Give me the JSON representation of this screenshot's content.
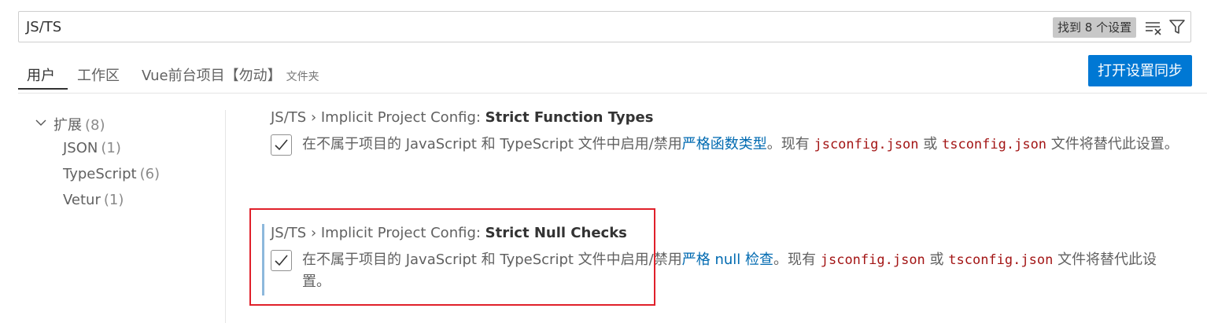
{
  "search": {
    "value": "JS/TS",
    "result_count": "找到 8 个设置"
  },
  "tabs": [
    {
      "label": "用户"
    },
    {
      "label": "工作区"
    },
    {
      "label": "Vue前台项目【勿动】",
      "sub": "文件夹"
    }
  ],
  "sync_button": "打开设置同步",
  "toc": {
    "group": {
      "label": "扩展",
      "count": "(8)"
    },
    "items": [
      {
        "label": "JSON",
        "count": "(1)"
      },
      {
        "label": "TypeScript",
        "count": "(6)"
      },
      {
        "label": "Vetur",
        "count": "(1)"
      }
    ]
  },
  "settings": [
    {
      "title_prefix": "JS/TS › Implicit Project Config: ",
      "title_name": "Strict Function Types",
      "checked": true,
      "desc_pre": "在不属于项目的 JavaScript 和 TypeScript 文件中启用/禁用",
      "desc_link": "严格函数类型",
      "desc_mid": "。现有 ",
      "code1": "jsconfig.json",
      "desc_or": " 或 ",
      "code2": "tsconfig.json",
      "desc_post": " 文件将替代此设置。"
    },
    {
      "title_prefix": "JS/TS › Implicit Project Config: ",
      "title_name": "Strict Null Checks",
      "checked": true,
      "desc_pre": "在不属于项目的 JavaScript 和 TypeScript 文件中启用/禁用",
      "desc_link": "严格 null 检查",
      "desc_mid": "。现有 ",
      "code1": "jsconfig.json",
      "desc_or": " 或 ",
      "code2": "tsconfig.json",
      "desc_post": " 文件将替代此设置。"
    }
  ],
  "colors": {
    "accent": "#0078d4",
    "link": "#006ab1",
    "code": "#a31515",
    "highlight": "#e0202a"
  }
}
